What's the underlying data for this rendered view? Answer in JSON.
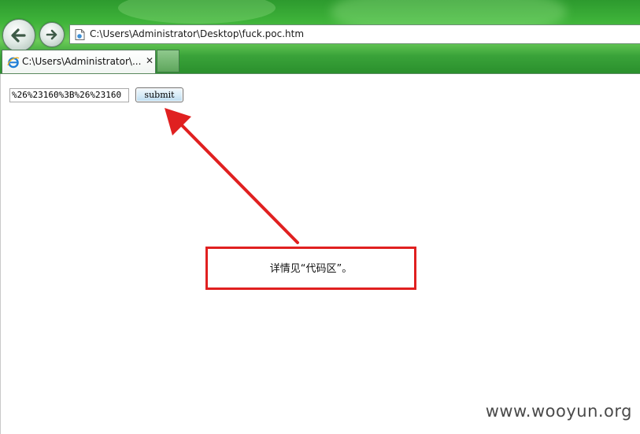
{
  "browser": {
    "address": "C:\\Users\\Administrator\\Desktop\\fuck.poc.htm",
    "tab_title": "C:\\Users\\Administrator\\...",
    "tab_close_glyph": "✕"
  },
  "form": {
    "input_value": "%26%23160%3B%26%23160",
    "submit_label": "submit"
  },
  "annotation": {
    "text": "详情见“代码区”。"
  },
  "watermark": "www.wooyun.org",
  "colors": {
    "annotation_red": "#e02020",
    "chrome_green": "#3fb43a"
  },
  "icons": [
    "back-arrow-icon",
    "forward-arrow-icon",
    "page-icon",
    "ie-icon",
    "close-icon"
  ]
}
